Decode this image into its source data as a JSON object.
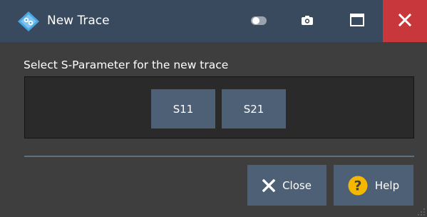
{
  "window": {
    "title": "New Trace",
    "icons": {
      "logo": "rohde-schwarz-logo-icon",
      "toggle": "toggle-icon",
      "screenshot": "camera-icon",
      "maximize": "maximize-icon",
      "close": "close-icon"
    }
  },
  "dialog": {
    "instruction": "Select S-Parameter for the new trace",
    "sparameters": [
      "S11",
      "S21"
    ]
  },
  "actions": {
    "close_label": "Close",
    "close_icon": "x-icon",
    "help_label": "Help",
    "help_icon": "question-mark-icon"
  },
  "colors": {
    "titlebar": "#3a4a5e",
    "close_button": "#c8373c",
    "dialog_background": "#3e3e3e",
    "button": "#4e6075",
    "help_icon": "#f5b800"
  }
}
